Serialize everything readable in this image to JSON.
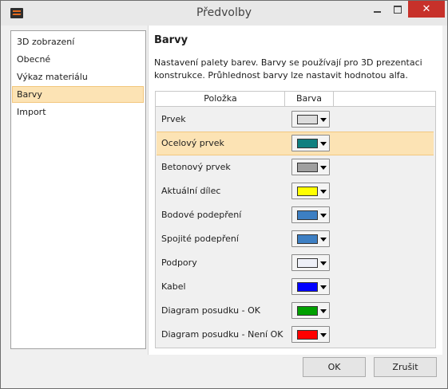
{
  "window": {
    "title": "Předvolby",
    "close_glyph": "✕"
  },
  "sidebar": {
    "items": [
      {
        "label": "3D zobrazení"
      },
      {
        "label": "Obecné"
      },
      {
        "label": "Výkaz materiálu"
      },
      {
        "label": "Barvy",
        "selected": true
      },
      {
        "label": "Import"
      }
    ]
  },
  "panel": {
    "title": "Barvy",
    "description": "Nastavení palety barev. Barvy se používají pro 3D prezentaci konstrukce. Průhlednost barvy lze nastavit hodnotou alfa.",
    "columns": {
      "item": "Položka",
      "color": "Barva"
    },
    "rows": [
      {
        "label": "Prvek",
        "color": "#dcdcdc"
      },
      {
        "label": "Ocelový prvek",
        "color": "#0f7f7f",
        "selected": true
      },
      {
        "label": "Betonový prvek",
        "color": "#a0a0a0"
      },
      {
        "label": "Aktuální dílec",
        "color": "#ffff00"
      },
      {
        "label": "Bodové podepření",
        "color": "#3d7fc3"
      },
      {
        "label": "Spojité podepření",
        "color": "#3d7fc3"
      },
      {
        "label": "Podpory",
        "color": "#eef0f8"
      },
      {
        "label": "Kabel",
        "color": "#0000ff"
      },
      {
        "label": "Diagram posudku - OK",
        "color": "#00a000"
      },
      {
        "label": "Diagram posudku - Není OK",
        "color": "#ff0000"
      }
    ]
  },
  "footer": {
    "ok_label": "OK",
    "cancel_label": "Zrušit"
  },
  "colors": {
    "selection_bg": "#fce3b4",
    "close_button": "#c7312a"
  },
  "icons": {
    "app": "app-logo-icon",
    "minimize": "minimize-icon",
    "maximize": "maximize-icon",
    "close": "close-icon",
    "dropdown": "dropdown-arrow-icon"
  }
}
